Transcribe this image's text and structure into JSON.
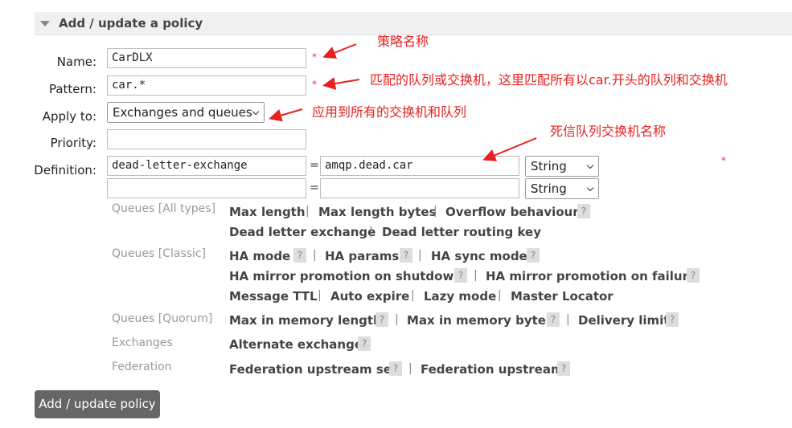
{
  "section": {
    "title": "Add / update a policy"
  },
  "form": {
    "name_label": "Name:",
    "name_value": "CarDLX",
    "pattern_label": "Pattern:",
    "pattern_value": "car.*",
    "apply_label": "Apply to:",
    "apply_value": "Exchanges and queues",
    "priority_label": "Priority:",
    "priority_value": "",
    "definition_label": "Definition:",
    "required_mark": "*",
    "equals": "=",
    "definitions": [
      {
        "key": "dead-letter-exchange",
        "value": "amqp.dead.car",
        "type": "String"
      },
      {
        "key": "",
        "value": "",
        "type": "String"
      }
    ]
  },
  "helpers": {
    "help_glyph": "?",
    "separator": "|",
    "queues_all": {
      "label": "Queues [All types]",
      "items": [
        "Max length",
        "Max length bytes",
        "Overflow behaviour",
        "Dead letter exchange",
        "Dead letter routing key"
      ]
    },
    "queues_classic": {
      "label": "Queues [Classic]",
      "items": [
        "HA mode",
        "HA params",
        "HA sync mode",
        "HA mirror promotion on shutdown",
        "HA mirror promotion on failure",
        "Message TTL",
        "Auto expire",
        "Lazy mode",
        "Master Locator"
      ]
    },
    "queues_quorum": {
      "label": "Queues [Quorum]",
      "items": [
        "Max in memory length",
        "Max in memory bytes",
        "Delivery limit"
      ]
    },
    "exchanges": {
      "label": "Exchanges",
      "items": [
        "Alternate exchange"
      ]
    },
    "federation": {
      "label": "Federation",
      "items": [
        "Federation upstream set",
        "Federation upstream"
      ]
    }
  },
  "submit_label": "Add / update policy",
  "annotations": {
    "name_note": "策略名称",
    "pattern_note": "匹配的队列或交换机，这里匹配所有以car.开头的队列和交换机",
    "apply_note": "应用到所有的交换机和队列",
    "dlx_note": "死信队列交换机名称"
  },
  "colors": {
    "annotation": "#e82020",
    "button": "#666666",
    "header": "#f0f0f0"
  }
}
